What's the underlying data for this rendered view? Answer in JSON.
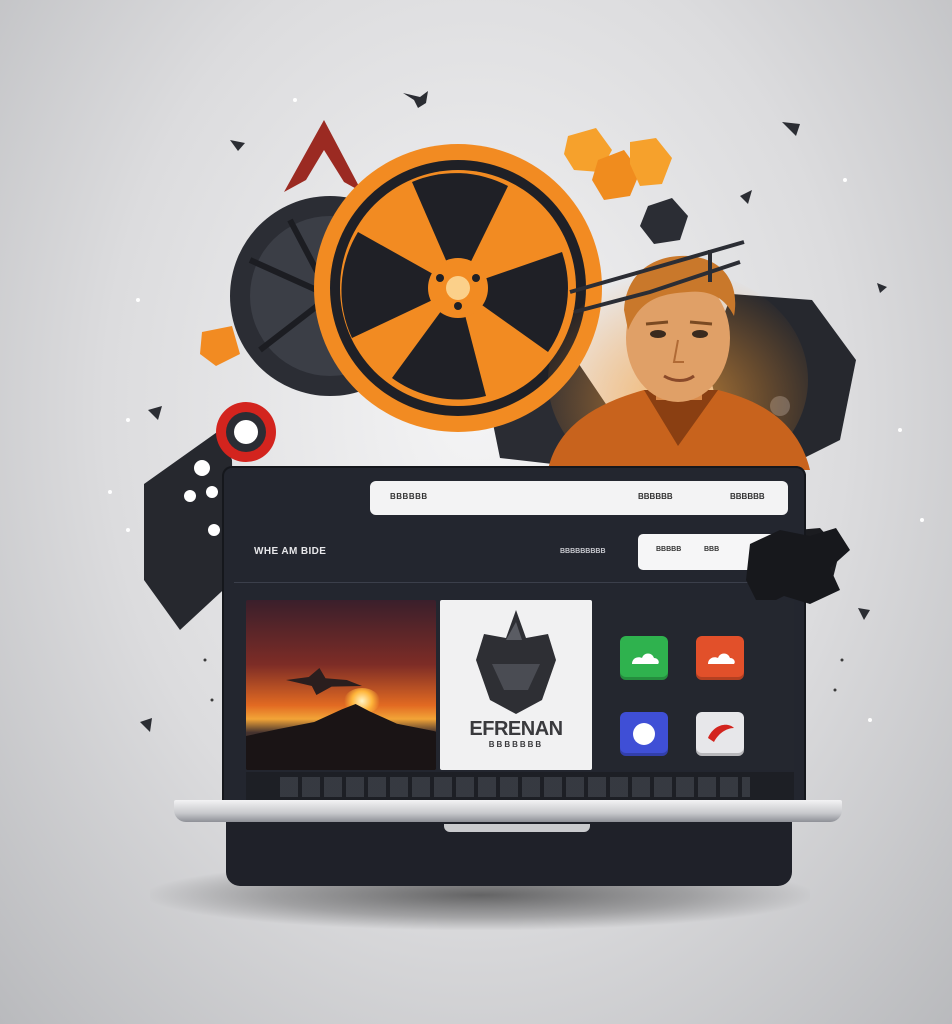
{
  "illustration": {
    "browser_bar": {
      "left_text": "BBBBBB",
      "mid_text": "BBBBBB",
      "right_text": "BBBBBB"
    },
    "site": {
      "title": "WHE AM BIDE",
      "nav_link": "BBBBBBBBB",
      "search_left": "BBBBB",
      "search_right": "BBB"
    },
    "logo_tile": {
      "name": "EFRENAN",
      "sub": "BBBBBBB"
    },
    "apps": [
      {
        "icon": "cloud-icon",
        "color": "#2fb24e"
      },
      {
        "icon": "cloud-icon",
        "color": "#e2502a"
      },
      {
        "icon": "blob-icon",
        "color": "#3f4fd6"
      },
      {
        "icon": "swoosh-icon",
        "color": "#e7e7ea"
      }
    ],
    "colors": {
      "reel_orange": "#f28b22",
      "dark": "#23262f",
      "accent_red": "#d3241e"
    }
  }
}
